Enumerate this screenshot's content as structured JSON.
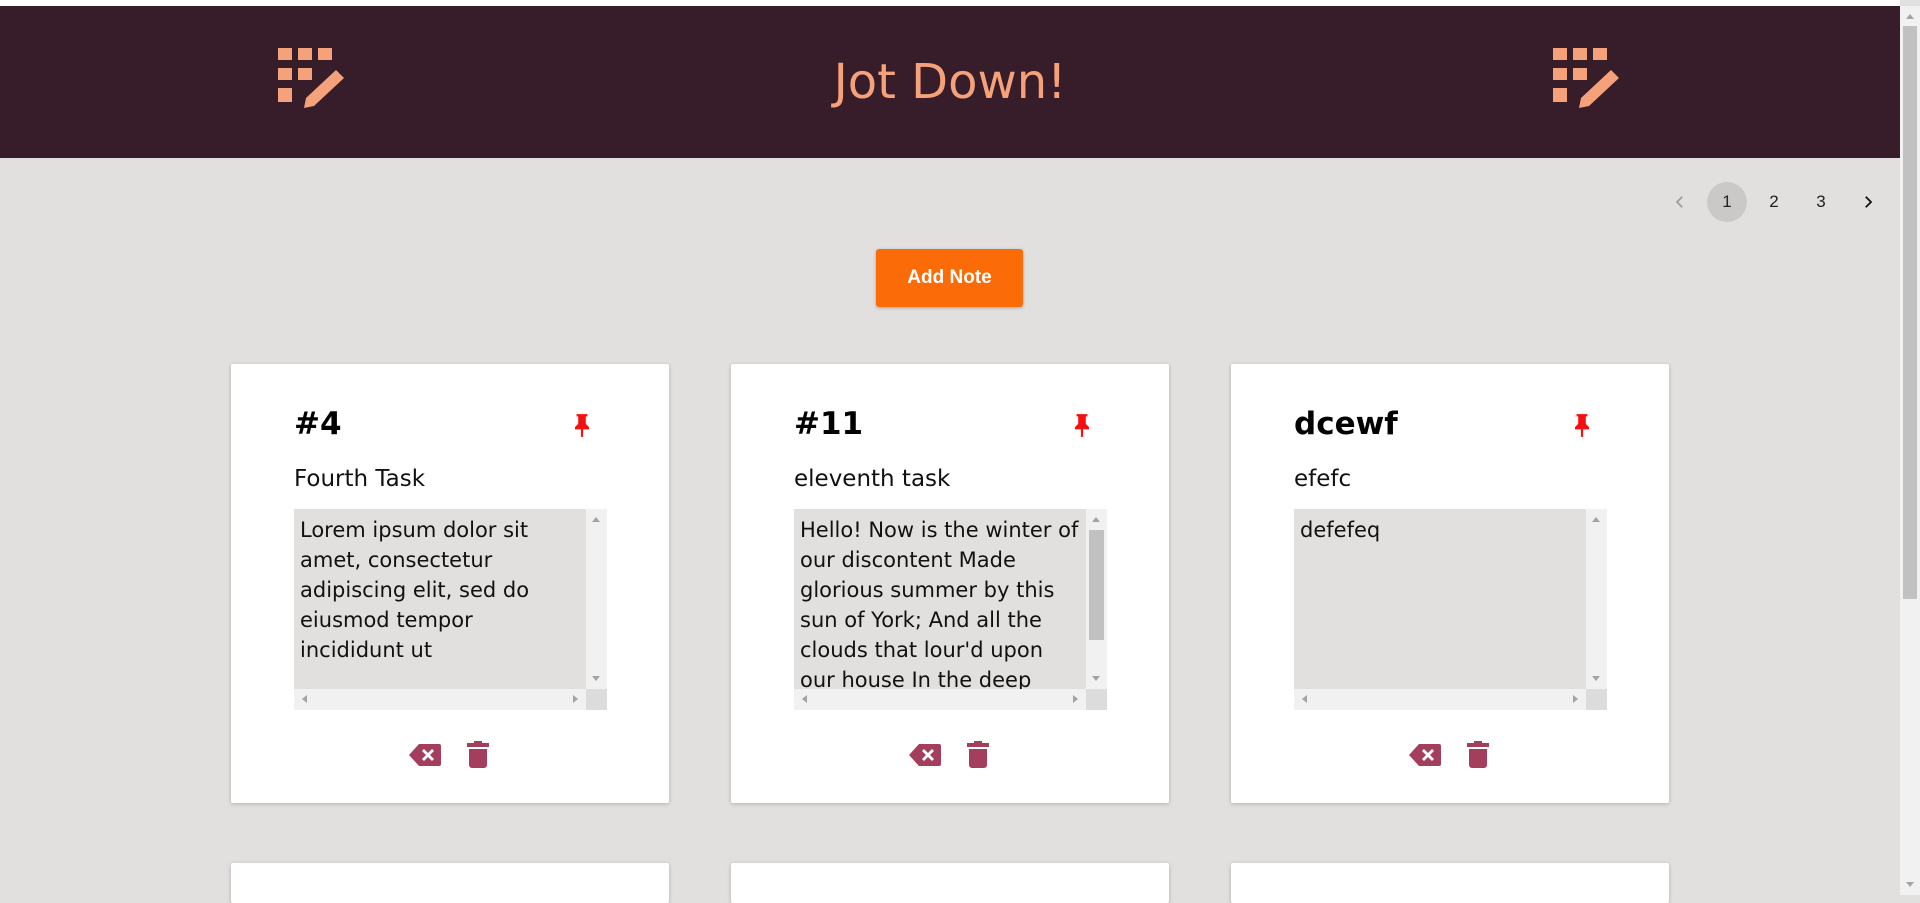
{
  "app": {
    "title": "Jot Down!",
    "colors": {
      "header_bg": "#371c2a",
      "title": "#f5a17a",
      "accent": "#fb6b08",
      "icon": "#a33f5d",
      "pin": "#f50f0f",
      "background": "#e2e0df"
    }
  },
  "header": {
    "left_logo_icon": "grid-pencil-icon",
    "right_logo_icon": "grid-pencil-icon"
  },
  "pagination": {
    "prev_icon": "chevron-left-icon",
    "next_icon": "chevron-right-icon",
    "pages": [
      "1",
      "2",
      "3"
    ],
    "current_page": "1"
  },
  "toolbar": {
    "add_note_label": "Add Note"
  },
  "notes": [
    {
      "title": "#4",
      "subtitle": "Fourth Task",
      "body": "Lorem ipsum dolor sit amet, consectetur adipiscing elit, sed do eiusmod tempor incididunt ut",
      "pinned": true
    },
    {
      "title": "#11",
      "subtitle": "eleventh task",
      "body": "Hello! Now is the winter of our discontent Made glorious summer by this sun of York; And all the clouds that lour'd upon our house In the deep bosom",
      "pinned": true
    },
    {
      "title": "dcewf",
      "subtitle": "efefc",
      "body": "defefeq",
      "pinned": true
    }
  ],
  "note_actions": {
    "clear_icon": "backspace-icon",
    "delete_icon": "trash-icon",
    "pin_icon": "pin-icon"
  }
}
